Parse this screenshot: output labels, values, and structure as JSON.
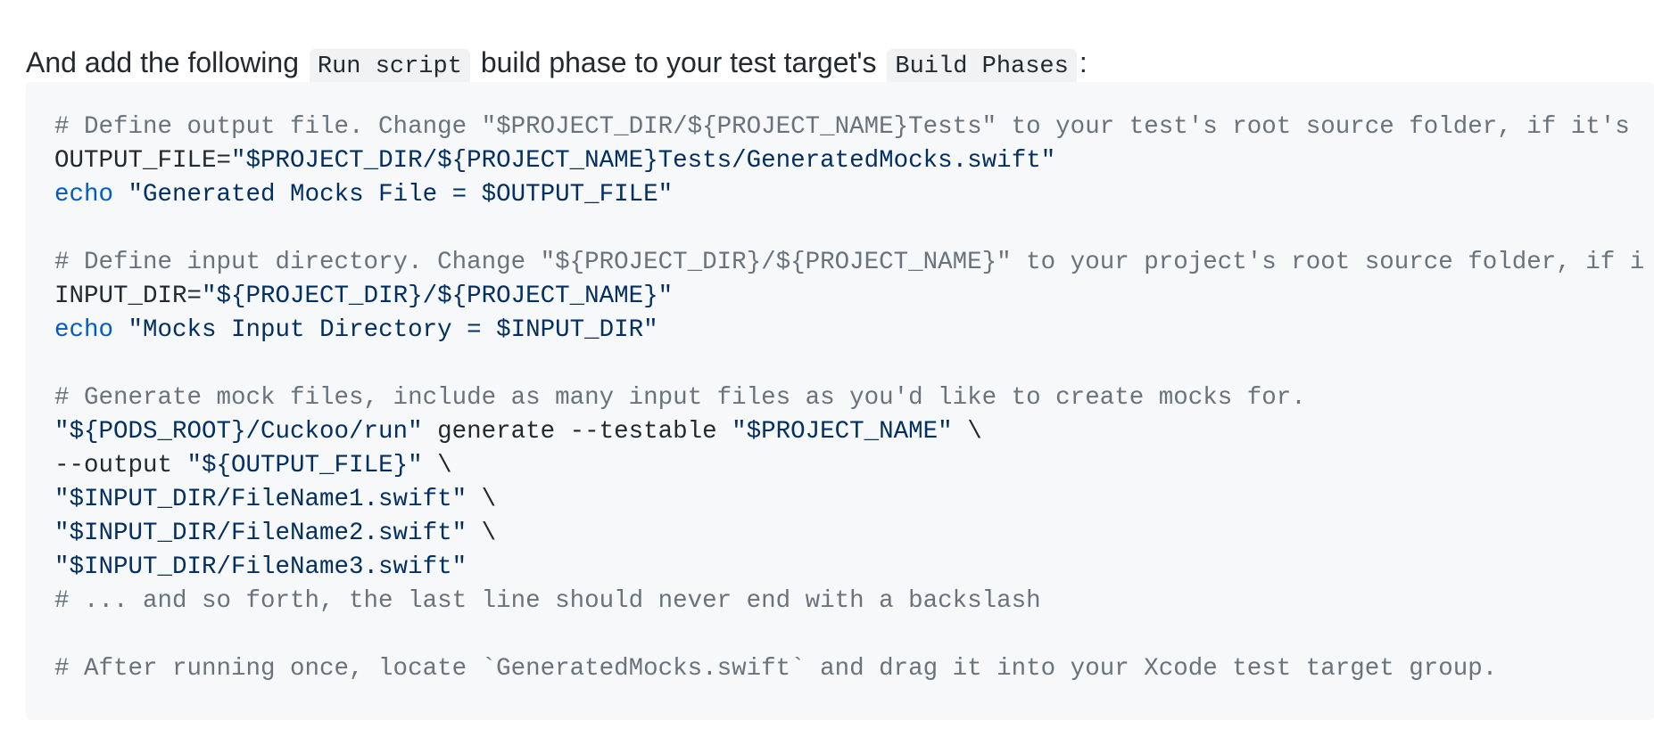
{
  "intro": {
    "before": "And add the following",
    "code1": "Run script",
    "middle": "build phase to your test target's",
    "code2": "Build Phases",
    "after": ":"
  },
  "code_lines": [
    [
      {
        "t": "comment",
        "v": "# Define output file. Change \"$PROJECT_DIR/${PROJECT_NAME}Tests\" to your test's root source folder, if it's"
      }
    ],
    [
      {
        "t": "plain",
        "v": "OUTPUT_FILE="
      },
      {
        "t": "string",
        "v": "\"$PROJECT_DIR/${PROJECT_NAME}Tests/GeneratedMocks.swift\""
      }
    ],
    [
      {
        "t": "keyword",
        "v": "echo"
      },
      {
        "t": "plain",
        "v": " "
      },
      {
        "t": "string",
        "v": "\"Generated Mocks File = $OUTPUT_FILE\""
      }
    ],
    [],
    [
      {
        "t": "comment",
        "v": "# Define input directory. Change \"${PROJECT_DIR}/${PROJECT_NAME}\" to your project's root source folder, if i"
      }
    ],
    [
      {
        "t": "plain",
        "v": "INPUT_DIR="
      },
      {
        "t": "string",
        "v": "\"${PROJECT_DIR}/${PROJECT_NAME}\""
      }
    ],
    [
      {
        "t": "keyword",
        "v": "echo"
      },
      {
        "t": "plain",
        "v": " "
      },
      {
        "t": "string",
        "v": "\"Mocks Input Directory = $INPUT_DIR\""
      }
    ],
    [],
    [
      {
        "t": "comment",
        "v": "# Generate mock files, include as many input files as you'd like to create mocks for."
      }
    ],
    [
      {
        "t": "string",
        "v": "\"${PODS_ROOT}/Cuckoo/run\""
      },
      {
        "t": "plain",
        "v": " generate --testable "
      },
      {
        "t": "string",
        "v": "\"$PROJECT_NAME\""
      },
      {
        "t": "plain",
        "v": " \\"
      }
    ],
    [
      {
        "t": "plain",
        "v": "--output "
      },
      {
        "t": "string",
        "v": "\"${OUTPUT_FILE}\""
      },
      {
        "t": "plain",
        "v": " \\"
      }
    ],
    [
      {
        "t": "string",
        "v": "\"$INPUT_DIR/FileName1.swift\""
      },
      {
        "t": "plain",
        "v": " \\"
      }
    ],
    [
      {
        "t": "string",
        "v": "\"$INPUT_DIR/FileName2.swift\""
      },
      {
        "t": "plain",
        "v": " \\"
      }
    ],
    [
      {
        "t": "string",
        "v": "\"$INPUT_DIR/FileName3.swift\""
      }
    ],
    [
      {
        "t": "comment",
        "v": "# ... and so forth, the last line should never end with a backslash"
      }
    ],
    [],
    [
      {
        "t": "comment",
        "v": "# After running once, locate `GeneratedMocks.swift` and drag it into your Xcode test target group."
      }
    ]
  ],
  "colors": {
    "comment": "#6a737d",
    "keyword": "#005cc5",
    "string": "#032f62",
    "plain": "#24292e",
    "code_background": "#f6f8fa"
  }
}
